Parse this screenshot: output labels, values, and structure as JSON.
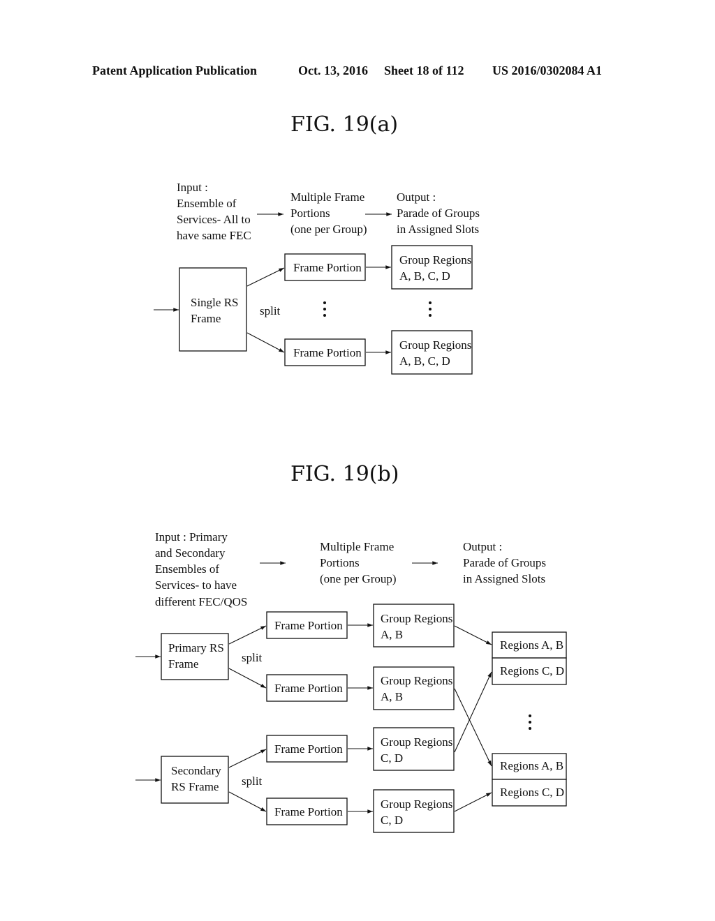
{
  "header": {
    "left": "Patent Application Publication",
    "date": "Oct. 13, 2016",
    "sheet": "Sheet 18 of 112",
    "number": "US 2016/0302084 A1"
  },
  "fig_a": {
    "title": "FIG. 19(a)",
    "input_label": [
      "Input :",
      "Ensemble of",
      "Services- All to",
      "have same FEC"
    ],
    "middle_label": [
      "Multiple Frame",
      "Portions",
      "(one per Group)"
    ],
    "output_label": [
      "Output :",
      "Parade of Groups",
      "in Assigned Slots"
    ],
    "source_box": [
      "Single RS",
      "Frame"
    ],
    "split_label": "split",
    "frame_portion": "Frame Portion",
    "group_regions": [
      "Group Regions",
      "A, B, C, D"
    ]
  },
  "fig_b": {
    "title": "FIG. 19(b)",
    "input_label": [
      "Input : Primary",
      "and Secondary",
      "Ensembles of",
      "Services- to have",
      "different FEC/QOS"
    ],
    "middle_label": [
      "Multiple Frame",
      "Portions",
      "(one per Group)"
    ],
    "output_label": [
      "Output :",
      "Parade of Groups",
      "in Assigned Slots"
    ],
    "primary_box": [
      "Primary RS",
      "Frame"
    ],
    "secondary_box": [
      "Secondary",
      "RS Frame"
    ],
    "split_label": "split",
    "frame_portion": "Frame Portion",
    "group_ab": [
      "Group Regions",
      "A, B"
    ],
    "group_cd": [
      "Group Regions",
      "C, D"
    ],
    "regions_ab": "Regions A, B",
    "regions_cd": "Regions C, D"
  }
}
